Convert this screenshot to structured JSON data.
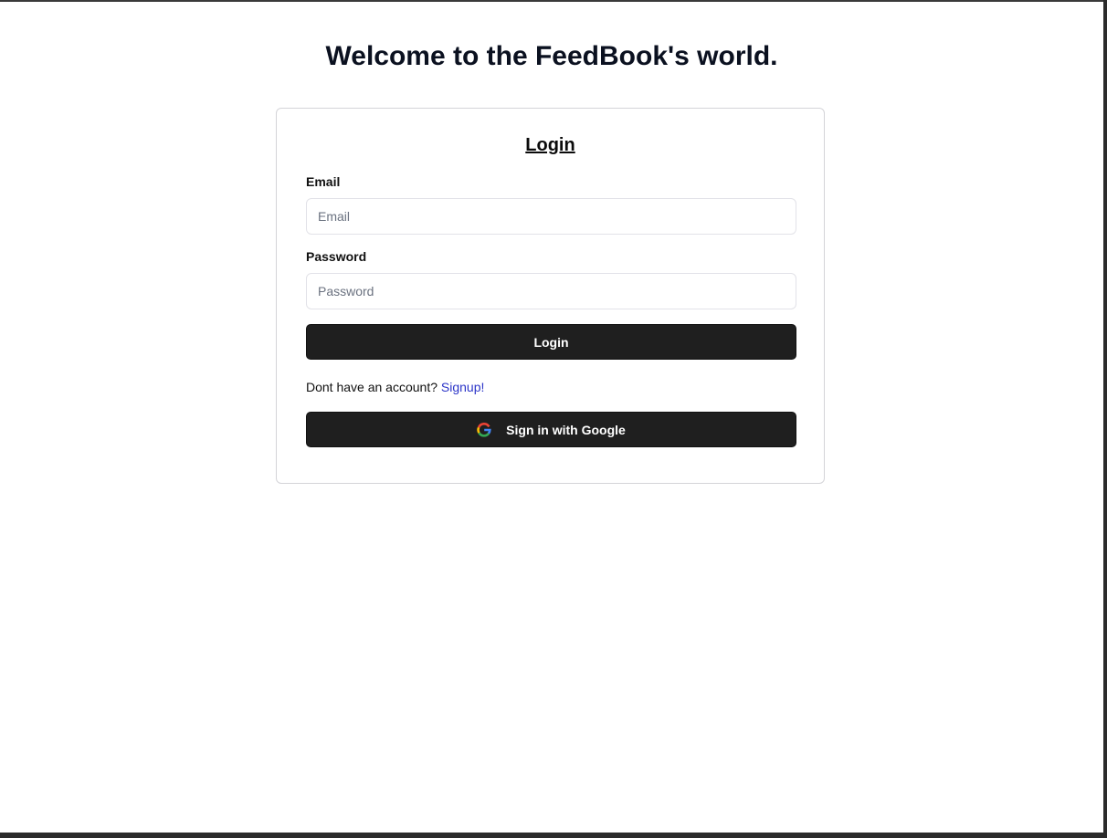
{
  "page": {
    "heading": "Welcome to the FeedBook's world."
  },
  "login_card": {
    "title": "Login",
    "email": {
      "label": "Email",
      "placeholder": "Email",
      "value": ""
    },
    "password": {
      "label": "Password",
      "placeholder": "Password",
      "value": ""
    },
    "login_button": "Login",
    "signup_prompt": "Dont have an account?",
    "signup_link": "Signup!",
    "google_button": "Sign in with Google",
    "google_icon": "google-g-icon"
  },
  "colors": {
    "button_bg": "#1f1f1f",
    "link": "#2c35c8",
    "border": "#d4d4d8"
  }
}
